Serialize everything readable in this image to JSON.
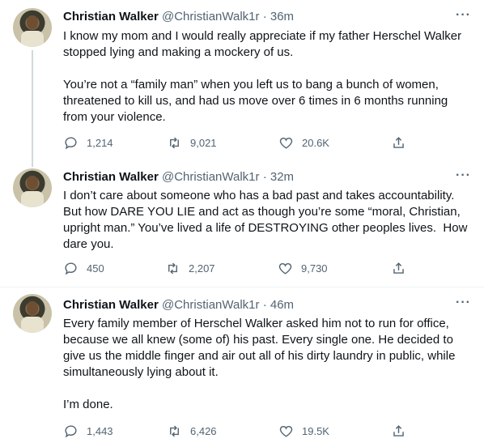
{
  "tweets": [
    {
      "name": "Christian Walker",
      "handle": "@ChristianWalk1r",
      "time": "· 36m",
      "text": "I know my mom and I would really appreciate if my father Herschel Walker stopped lying and making a mockery of us.\n\nYou’re not a “family man” when you left us to bang a bunch of women, threatened to kill us, and had us move over 6 times in 6 months running from your violence.",
      "replies": "1,214",
      "retweets": "9,021",
      "likes": "20.6K"
    },
    {
      "name": "Christian Walker",
      "handle": "@ChristianWalk1r",
      "time": "· 32m",
      "text": "I don’t care about someone who has a bad past and takes accountability. But how DARE YOU LIE and act as though you’re some “moral, Christian, upright man.” You’ve lived a life of DESTROYING other peoples lives.  How dare you.",
      "replies": "450",
      "retweets": "2,207",
      "likes": "9,730"
    },
    {
      "name": "Christian Walker",
      "handle": "@ChristianWalk1r",
      "time": "· 46m",
      "text": "Every family member of Herschel Walker asked him not to run for office, because we all knew (some of) his past. Every single one. He decided to give us the middle finger and air out all of his dirty laundry in public, while simultaneously lying about it.\n\nI’m done.",
      "replies": "1,443",
      "retweets": "6,426",
      "likes": "19.5K"
    }
  ],
  "icons": [
    "reply-icon",
    "retweet-icon",
    "like-icon",
    "share-icon",
    "more-icon"
  ],
  "colors": {
    "text": "#0f1419",
    "secondary": "#536471",
    "divider": "#eff3f4",
    "thread_line": "#cfd9de"
  }
}
